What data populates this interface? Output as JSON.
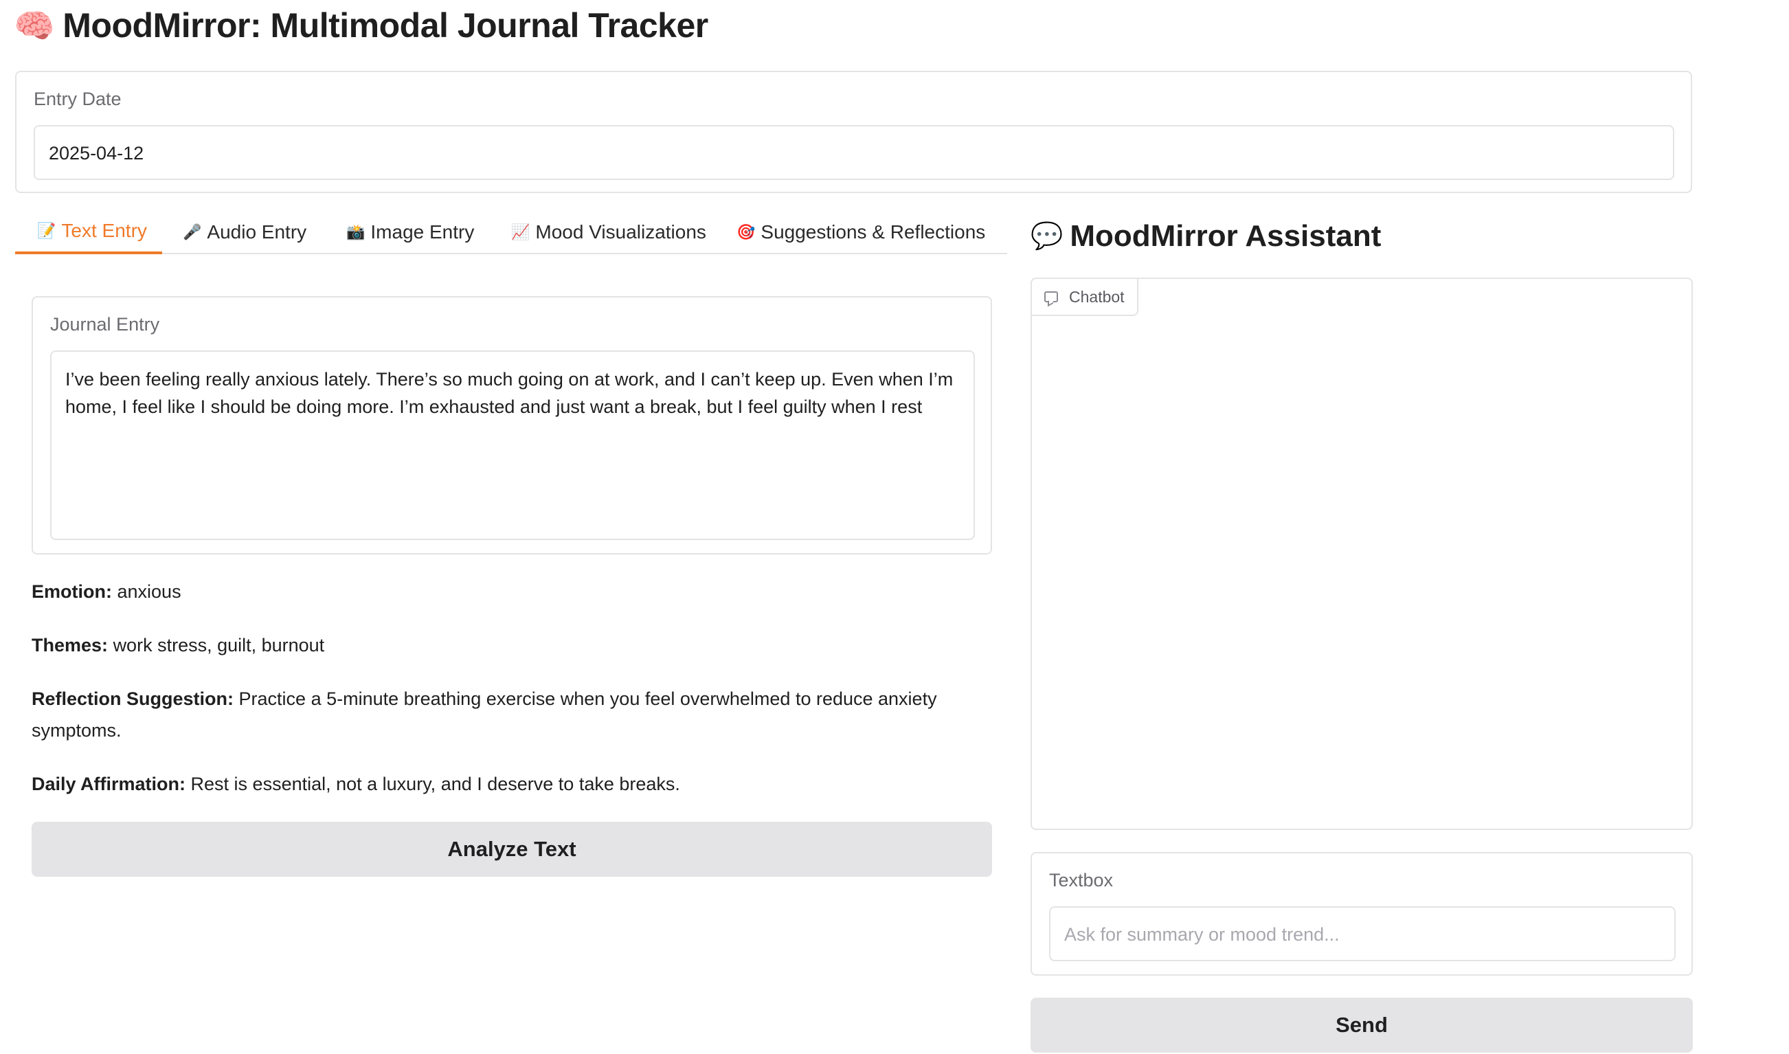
{
  "app": {
    "title_icon": "brain-emoji",
    "title": "MoodMirror: Multimodal Journal Tracker"
  },
  "date": {
    "label": "Entry Date",
    "value": "2025-04-12"
  },
  "tabs": [
    {
      "icon": "📝",
      "label": "Text Entry",
      "active": true
    },
    {
      "icon": "🎤",
      "label": "Audio Entry",
      "active": false
    },
    {
      "icon": "📸",
      "label": "Image Entry",
      "active": false
    },
    {
      "icon": "📈",
      "label": "Mood Visualizations",
      "active": false
    },
    {
      "icon": "🎯",
      "label": "Suggestions & Reflections",
      "active": false
    }
  ],
  "journal": {
    "label": "Journal Entry",
    "value": "I’ve been feeling really anxious lately. There’s so much going on at work, and I can’t keep up. Even when I’m home, I feel like I should be doing more. I’m exhausted and just want a break, but I feel guilty when I rest"
  },
  "results": {
    "emotion_label": "Emotion:",
    "emotion_value": "anxious",
    "themes_label": "Themes:",
    "themes_value": "work stress, guilt, burnout",
    "reflection_label": "Reflection Suggestion:",
    "reflection_value": "Practice a 5-minute breathing exercise when you feel overwhelmed to reduce anxiety symptoms.",
    "affirmation_label": "Daily Affirmation:",
    "affirmation_value": "Rest is essential, not a luxury, and I deserve to take breaks."
  },
  "analyze_button": "Analyze Text",
  "assistant": {
    "title_icon": "speech-bubble-emoji",
    "title": "MoodMirror Assistant",
    "chatbot_label": "Chatbot",
    "textbox_label": "Textbox",
    "textbox_placeholder": "Ask for summary or mood trend...",
    "send_button": "Send"
  },
  "colors": {
    "accent": "#f07a2a",
    "border": "#e4e4e7",
    "button_bg": "#e4e4e7"
  }
}
